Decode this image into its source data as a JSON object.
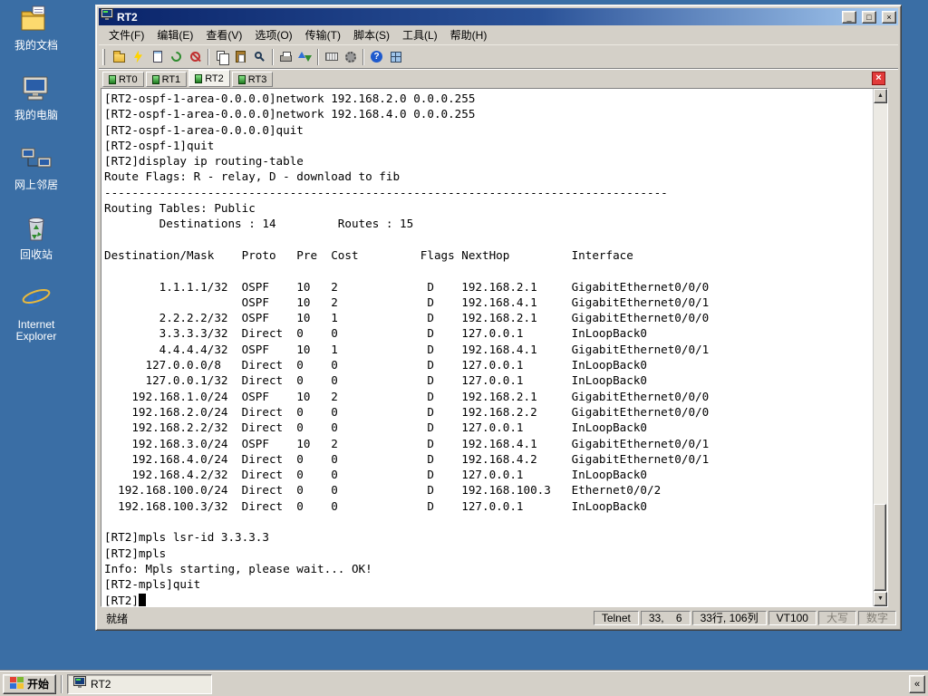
{
  "colors": {
    "desktop": "#3A6EA5",
    "chrome": "#D4D0C8",
    "titlebar_start": "#0A246A",
    "titlebar_end": "#A6CAF0",
    "close_session_button": "#E23B3B"
  },
  "desktop_icons": [
    {
      "label": "我的文档"
    },
    {
      "label": "我的电脑"
    },
    {
      "label": "网上邻居"
    },
    {
      "label": "回收站"
    },
    {
      "label": "Internet Explorer"
    }
  ],
  "window": {
    "title": "RT2",
    "menu": [
      "文件(F)",
      "编辑(E)",
      "查看(V)",
      "选项(O)",
      "传输(T)",
      "脚本(S)",
      "工具(L)",
      "帮助(H)"
    ],
    "toolbar": [
      {
        "name": "connect-icon",
        "shape": "folder"
      },
      {
        "name": "quick-connect-icon",
        "shape": "bolt"
      },
      {
        "name": "connect-in-tab-icon",
        "shape": "page"
      },
      {
        "name": "reconnect-icon",
        "shape": "reconnect"
      },
      {
        "name": "disconnect-icon",
        "shape": "disconnect"
      },
      {
        "name": "toolbar-separator",
        "shape": "sep"
      },
      {
        "name": "copy-icon",
        "shape": "copy"
      },
      {
        "name": "paste-icon",
        "shape": "paste"
      },
      {
        "name": "find-icon",
        "shape": "find"
      },
      {
        "name": "toolbar-separator",
        "shape": "sep"
      },
      {
        "name": "print-icon",
        "shape": "print"
      },
      {
        "name": "zmodem-transfer-icon",
        "shape": "transfer"
      },
      {
        "name": "toolbar-separator",
        "shape": "sep"
      },
      {
        "name": "keymap-icon",
        "shape": "keyboard"
      },
      {
        "name": "session-options-icon",
        "shape": "gear"
      },
      {
        "name": "toolbar-separator",
        "shape": "sep"
      },
      {
        "name": "help-icon",
        "shape": "help",
        "glyph": "?"
      },
      {
        "name": "session-tabs-icon",
        "shape": "grid"
      }
    ],
    "tabs": [
      "RT0",
      "RT1",
      "RT2",
      "RT3"
    ],
    "active_tab": "RT2",
    "terminal": {
      "lines": [
        "[RT2-ospf-1-area-0.0.0.0]network 192.168.2.0 0.0.0.255",
        "[RT2-ospf-1-area-0.0.0.0]network 192.168.4.0 0.0.0.255",
        "[RT2-ospf-1-area-0.0.0.0]quit",
        "[RT2-ospf-1]quit",
        "[RT2]display ip routing-table",
        "Route Flags: R - relay, D - download to fib",
        "----------------------------------------------------------------------------------",
        "Routing Tables: Public",
        "        Destinations : 14         Routes : 15",
        "",
        "Destination/Mask    Proto   Pre  Cost         Flags NextHop         Interface",
        "",
        "        1.1.1.1/32  OSPF    10   2             D    192.168.2.1     GigabitEthernet0/0/0",
        "                    OSPF    10   2             D    192.168.4.1     GigabitEthernet0/0/1",
        "        2.2.2.2/32  OSPF    10   1             D    192.168.2.1     GigabitEthernet0/0/0",
        "        3.3.3.3/32  Direct  0    0             D    127.0.0.1       InLoopBack0",
        "        4.4.4.4/32  OSPF    10   1             D    192.168.4.1     GigabitEthernet0/0/1",
        "      127.0.0.0/8   Direct  0    0             D    127.0.0.1       InLoopBack0",
        "      127.0.0.1/32  Direct  0    0             D    127.0.0.1       InLoopBack0",
        "    192.168.1.0/24  OSPF    10   2             D    192.168.2.1     GigabitEthernet0/0/0",
        "    192.168.2.0/24  Direct  0    0             D    192.168.2.2     GigabitEthernet0/0/0",
        "    192.168.2.2/32  Direct  0    0             D    127.0.0.1       InLoopBack0",
        "    192.168.3.0/24  OSPF    10   2             D    192.168.4.1     GigabitEthernet0/0/1",
        "    192.168.4.0/24  Direct  0    0             D    192.168.4.2     GigabitEthernet0/0/1",
        "    192.168.4.2/32  Direct  0    0             D    127.0.0.1       InLoopBack0",
        "  192.168.100.0/24  Direct  0    0             D    192.168.100.3   Ethernet0/0/2",
        "  192.168.100.3/32  Direct  0    0             D    127.0.0.1       InLoopBack0",
        "",
        "[RT2]mpls lsr-id 3.3.3.3",
        "[RT2]mpls",
        "Info: Mpls starting, please wait... OK!",
        "[RT2-mpls]quit",
        "[RT2]"
      ]
    },
    "status": {
      "ready": "就绪",
      "protocol": "Telnet",
      "cursor_pos": "33,    6",
      "dimensions": "33行, 106列",
      "emulation": "VT100",
      "caps": "大写",
      "num": "数字"
    },
    "buttons": {
      "minimize": "_",
      "maximize": "□",
      "close": "×"
    }
  },
  "taskbar": {
    "start": "开始",
    "tasks": [
      "RT2"
    ],
    "overflow": "«"
  }
}
